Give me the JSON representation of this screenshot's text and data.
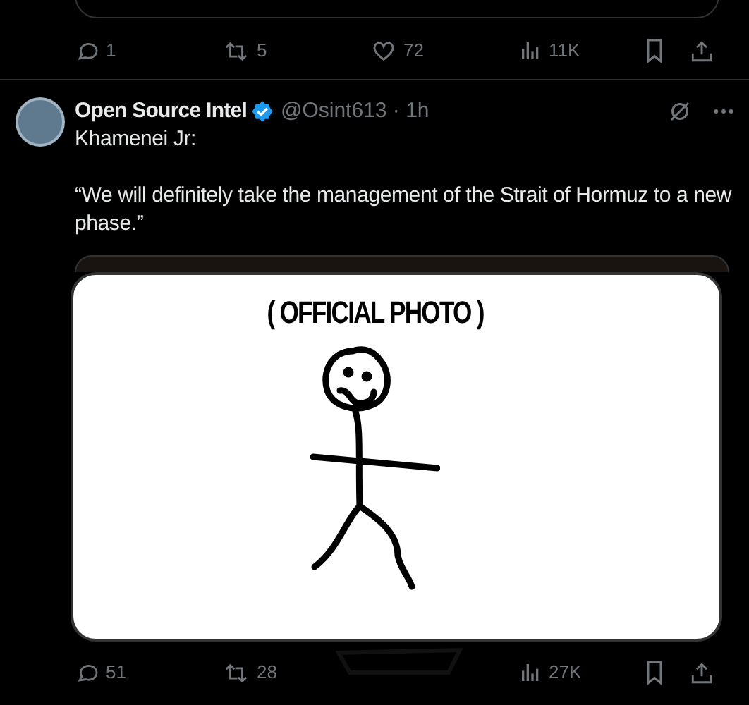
{
  "previous_post": {
    "actions": [
      {
        "kind": "reply",
        "count": "1"
      },
      {
        "kind": "repost",
        "count": "5"
      },
      {
        "kind": "like",
        "count": "72"
      },
      {
        "kind": "views",
        "count": "11K"
      },
      {
        "kind": "bookmark"
      },
      {
        "kind": "share"
      }
    ]
  },
  "post": {
    "name": "Open Source Intel",
    "verified": true,
    "handle": "@Osint613 · 1h",
    "text": [
      "Khamenei Jr:",
      "“We will definitely take the management of the Strait of Hormuz to a new phase.”"
    ],
    "image": {
      "caption": "( OFFICIAL PHOTO )"
    },
    "actions": [
      {
        "kind": "reply",
        "count": "51"
      },
      {
        "kind": "repost",
        "count": "28"
      },
      {
        "kind": "scribble"
      },
      {
        "kind": "views",
        "count": "27K"
      },
      {
        "kind": "bookmark"
      },
      {
        "kind": "share"
      }
    ]
  }
}
